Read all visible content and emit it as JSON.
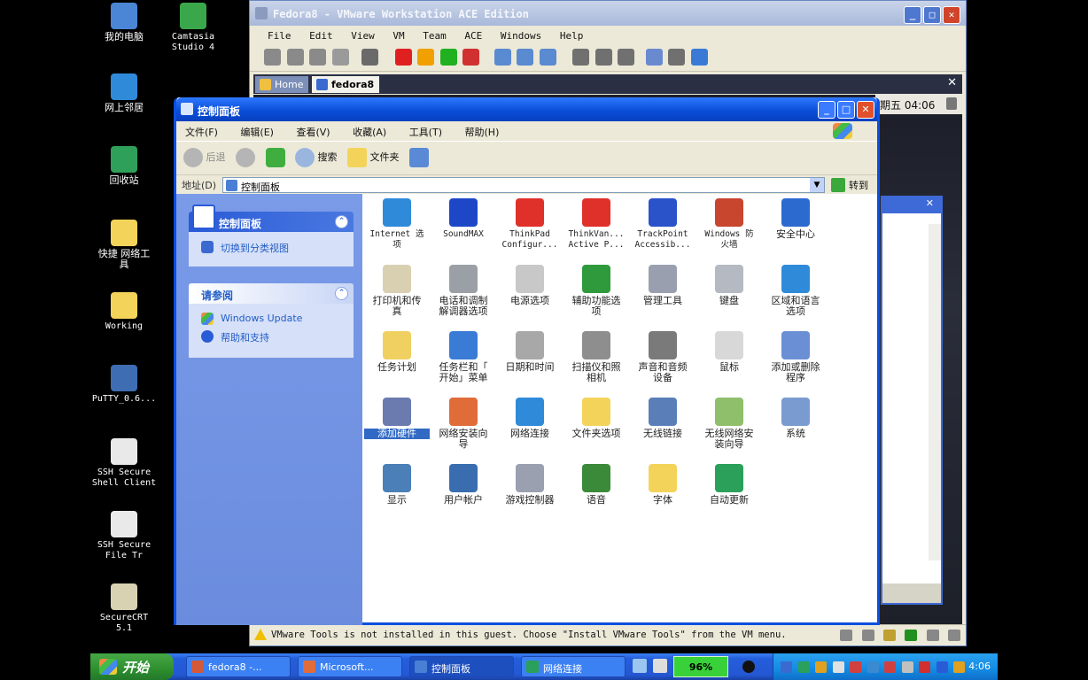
{
  "desktop": {
    "icons": [
      {
        "label": "我的电脑",
        "name": "my-computer-icon",
        "color": "#4b86d6"
      },
      {
        "label": "Camtasia\nStudio 4",
        "name": "camtasia-icon",
        "color": "#3aa84a"
      },
      {
        "label": "网上邻居",
        "name": "network-places-icon",
        "color": "#2f8ad9"
      },
      {
        "label": "回收站",
        "name": "recycle-bin-icon",
        "color": "#2fa05a"
      },
      {
        "label": "快捷 网络工\n具",
        "name": "shortcut-folder-icon",
        "color": "#f4d35a"
      },
      {
        "label": "Working",
        "name": "working-folder-icon",
        "color": "#f4d35a"
      },
      {
        "label": "PuTTY_0.6...",
        "name": "putty-icon",
        "color": "#3e6db4"
      },
      {
        "label": "SSH Secure\nShell Client",
        "name": "ssh-shell-icon",
        "color": "#e9e9e9"
      },
      {
        "label": "SSH Secure\nFile Tr",
        "name": "ssh-file-icon",
        "color": "#e9e9e9"
      },
      {
        "label": "SecureCRT\n5.1",
        "name": "securecrt-icon",
        "color": "#d9d2b2"
      }
    ]
  },
  "vmware": {
    "title": "Fedora8 - VMware Workstation ACE Edition",
    "menu": [
      "File",
      "Edit",
      "View",
      "VM",
      "Team",
      "ACE",
      "Windows",
      "Help"
    ],
    "tabs": [
      {
        "label": "Home",
        "active": false
      },
      {
        "label": "fedora8",
        "active": true
      }
    ],
    "guest_clock": "期五 04:06",
    "status_text": "VMware Tools is not installed in this guest. Choose \"Install VMware Tools\" from the VM menu."
  },
  "controlpanel": {
    "title": "控制面板",
    "menu": [
      "文件(F)",
      "编辑(E)",
      "查看(V)",
      "收藏(A)",
      "工具(T)",
      "帮助(H)"
    ],
    "nav": {
      "back": "后退",
      "search": "搜索",
      "folders": "文件夹"
    },
    "address_label": "地址(D)",
    "address_value": "控制面板",
    "go_label": "转到",
    "panel_box": {
      "title": "控制面板",
      "link": "切换到分类视图"
    },
    "see_also": {
      "title": "请参阅",
      "links": [
        "Windows Update",
        "帮助和支持"
      ]
    },
    "items": [
      {
        "label": "Internet 选\n项",
        "mono": true,
        "color": "#2f8ad9"
      },
      {
        "label": "SoundMAX",
        "mono": true,
        "color": "#1d47c7"
      },
      {
        "label": "ThinkPad\nConfigur...",
        "mono": true,
        "color": "#e0302a"
      },
      {
        "label": "ThinkVan...\nActive P...",
        "mono": true,
        "color": "#e0302a"
      },
      {
        "label": "TrackPoint\nAccessib...",
        "mono": true,
        "color": "#2a52c9"
      },
      {
        "label": "Windows 防\n火墙",
        "mono": true,
        "color": "#c8452e"
      },
      {
        "label": "安全中心",
        "mono": false,
        "color": "#2d6ad0"
      },
      {
        "label": "打印机和传\n真",
        "mono": false,
        "color": "#d9d0b2"
      },
      {
        "label": "电话和调制\n解调器选项",
        "mono": false,
        "color": "#9aa0a6"
      },
      {
        "label": "电源选项",
        "mono": false,
        "color": "#c8c8c8"
      },
      {
        "label": "辅助功能选\n项",
        "mono": false,
        "color": "#2e9a3c"
      },
      {
        "label": "管理工具",
        "mono": false,
        "color": "#9a9fb0"
      },
      {
        "label": "键盘",
        "mono": false,
        "color": "#b5b9c2"
      },
      {
        "label": "区域和语言\n选项",
        "mono": false,
        "color": "#2f8ad9"
      },
      {
        "label": "任务计划",
        "mono": false,
        "color": "#f0d060"
      },
      {
        "label": "任务栏和「\n开始」菜单",
        "mono": false,
        "color": "#3a7bd5"
      },
      {
        "label": "日期和时间",
        "mono": false,
        "color": "#a8a8a8"
      },
      {
        "label": "扫描仪和照\n相机",
        "mono": false,
        "color": "#8e8e8e"
      },
      {
        "label": "声音和音频\n设备",
        "mono": false,
        "color": "#7a7a7a"
      },
      {
        "label": "鼠标",
        "mono": false,
        "color": "#d8d8d8"
      },
      {
        "label": "添加或删除\n程序",
        "mono": false,
        "color": "#6a8fd4"
      },
      {
        "label": "添加硬件",
        "mono": false,
        "color": "#6b7bb0",
        "selected": true
      },
      {
        "label": "网络安装向\n导",
        "mono": false,
        "color": "#e06c3a"
      },
      {
        "label": "网络连接",
        "mono": false,
        "color": "#2f8ad9"
      },
      {
        "label": "文件夹选项",
        "mono": false,
        "color": "#f4d35a"
      },
      {
        "label": "无线链接",
        "mono": false,
        "color": "#5a7fb8"
      },
      {
        "label": "无线网络安\n装向导",
        "mono": false,
        "color": "#8fbf6a"
      },
      {
        "label": "系统",
        "mono": false,
        "color": "#7a9bd0"
      },
      {
        "label": "显示",
        "mono": false,
        "color": "#4a7fb8"
      },
      {
        "label": "用户帐户",
        "mono": false,
        "color": "#3a6db0"
      },
      {
        "label": "游戏控制器",
        "mono": false,
        "color": "#9aa0b0"
      },
      {
        "label": "语音",
        "mono": false,
        "color": "#3a8a3a"
      },
      {
        "label": "字体",
        "mono": false,
        "color": "#f4d35a"
      },
      {
        "label": "自动更新",
        "mono": false,
        "color": "#2aa05a"
      }
    ]
  },
  "taskbar": {
    "start": "开始",
    "tasks": [
      {
        "label": "fedora8 -...",
        "color": "#d25a3a"
      },
      {
        "label": "Microsoft...",
        "color": "#e06c3a"
      },
      {
        "label": "控制面板",
        "color": "#4a7fd6",
        "active": true
      },
      {
        "label": "网络连接",
        "color": "#2aa05a"
      }
    ],
    "battery": "96%",
    "clock": "4:06"
  }
}
